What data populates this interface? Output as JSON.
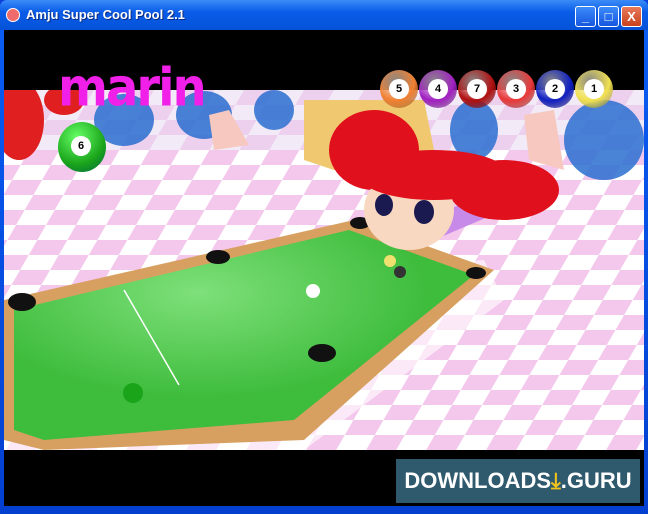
{
  "window": {
    "title": "Amju Super Cool Pool 2.1",
    "minimize": "_",
    "maximize": "□",
    "close": "X"
  },
  "game": {
    "player_name": "marin",
    "current_ball": {
      "number": "6",
      "color": "#1aa41a"
    },
    "remaining_balls": [
      {
        "number": "5",
        "color": "#f08030"
      },
      {
        "number": "4",
        "color": "#a020c0"
      },
      {
        "number": "7",
        "color": "#b01010"
      },
      {
        "number": "3",
        "color": "#e83838"
      },
      {
        "number": "2",
        "color": "#1020c0"
      },
      {
        "number": "1",
        "color": "#f0e050"
      }
    ]
  },
  "watermark": {
    "left": "DOWNLOADS",
    "icon": "download-arrow-icon",
    "right": ".GURU"
  }
}
